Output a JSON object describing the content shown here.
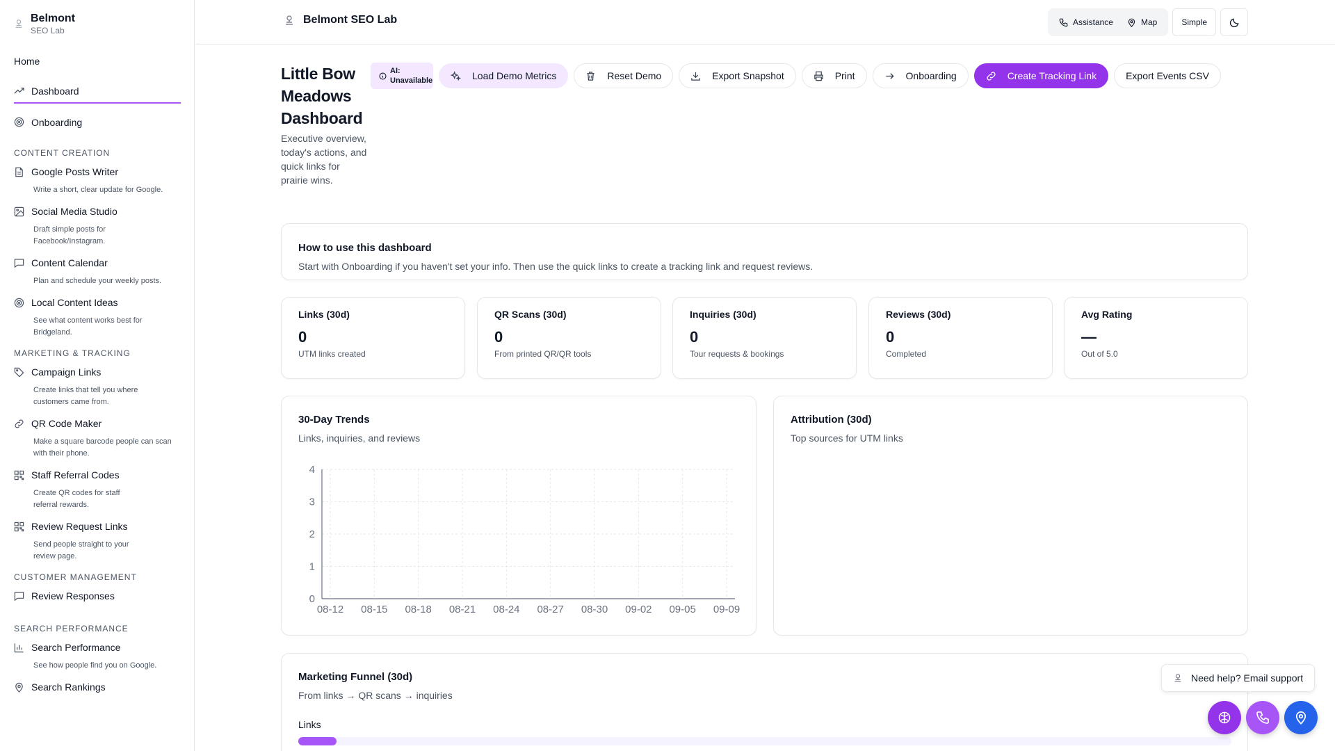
{
  "brand": {
    "title": "Belmont",
    "subtitle": "SEO Lab"
  },
  "sidebar": {
    "home": "Home",
    "dashboard": "Dashboard",
    "onboarding": "Onboarding",
    "sections": [
      {
        "title": "CONTENT CREATION",
        "items": [
          {
            "label": "Google Posts Writer",
            "desc": "Write a short, clear update for Google.",
            "icon": "document-icon"
          },
          {
            "label": "Social Media Studio",
            "desc": "Draft simple posts for Facebook/Instagram.",
            "icon": "image-icon"
          },
          {
            "label": "Content Calendar",
            "desc": "Plan and schedule your weekly posts.",
            "icon": "chat-icon"
          },
          {
            "label": "Local Content Ideas",
            "desc": "See what content works best for Bridgeland.",
            "icon": "target-icon"
          }
        ]
      },
      {
        "title": "MARKETING & TRACKING",
        "items": [
          {
            "label": "Campaign Links",
            "desc": "Create links that tell you where customers came from.",
            "icon": "tag-icon"
          },
          {
            "label": "QR Code Maker",
            "desc": "Make a square barcode people can scan with their phone.",
            "icon": "link-icon"
          },
          {
            "label": "Staff Referral Codes",
            "desc": "Create QR codes for staff referral rewards.",
            "icon": "qr-icon"
          },
          {
            "label": "Review Request Links",
            "desc": "Send people straight to your review page.",
            "icon": "qr-icon"
          }
        ]
      },
      {
        "title": "CUSTOMER MANAGEMENT",
        "items": [
          {
            "label": "Review Responses",
            "desc": "",
            "icon": "chat-icon"
          }
        ]
      },
      {
        "title": "SEARCH PERFORMANCE",
        "items": [
          {
            "label": "Search Performance",
            "desc": "See how people find you on Google.",
            "icon": "bar-chart-icon"
          },
          {
            "label": "Search Rankings",
            "desc": "",
            "icon": "map-pin-icon"
          }
        ]
      }
    ]
  },
  "header": {
    "app_title": "Belmont SEO Lab",
    "assistance": "Assistance",
    "map": "Map",
    "simple": "Simple"
  },
  "page": {
    "title": "Little Bow Meadows Dashboard",
    "subtitle": "Executive overview, today's actions, and quick links for prairie wins.",
    "ai_badge": "AI: Unavailable",
    "actions": {
      "load_demo": "Load Demo Metrics",
      "reset_demo": "Reset Demo",
      "export_snapshot": "Export Snapshot",
      "print": "Print",
      "onboarding": "Onboarding",
      "create_link": "Create Tracking Link",
      "export_csv": "Export Events CSV"
    }
  },
  "howto": {
    "title": "How to use this dashboard",
    "text": "Start with Onboarding if you haven't set your info. Then use the quick links to create a tracking link and request reviews."
  },
  "stats": [
    {
      "label": "Links (30d)",
      "value": "0",
      "sub": "UTM links created"
    },
    {
      "label": "QR Scans (30d)",
      "value": "0",
      "sub": "From printed QR/QR tools"
    },
    {
      "label": "Inquiries (30d)",
      "value": "0",
      "sub": "Tour requests & bookings"
    },
    {
      "label": "Reviews (30d)",
      "value": "0",
      "sub": "Completed"
    },
    {
      "label": "Avg Rating",
      "value": "—",
      "sub": "Out of 5.0"
    }
  ],
  "trends": {
    "title": "30-Day Trends",
    "subtitle": "Links, inquiries, and reviews"
  },
  "attribution": {
    "title": "Attribution (30d)",
    "subtitle": "Top sources for UTM links"
  },
  "funnel": {
    "title": "Marketing Funnel (30d)",
    "subtitle": "From links → QR scans → inquiries",
    "first_label": "Links",
    "first_fill_fraction": 0.041
  },
  "help": {
    "label": "Need help? Email support"
  },
  "colors": {
    "accent": "#9333ea",
    "accent_soft": "#f3e8ff",
    "fab_purple": "#9333ea",
    "fab_violet": "#a855f7",
    "fab_blue": "#2563eb"
  },
  "chart_data": {
    "type": "line",
    "title": "30-Day Trends",
    "x": [
      "08-12",
      "08-15",
      "08-18",
      "08-21",
      "08-24",
      "08-27",
      "08-30",
      "09-02",
      "09-05",
      "09-09"
    ],
    "ylim": [
      0,
      4
    ],
    "yticks": [
      0,
      1,
      2,
      3,
      4
    ],
    "grid": true,
    "series": []
  }
}
